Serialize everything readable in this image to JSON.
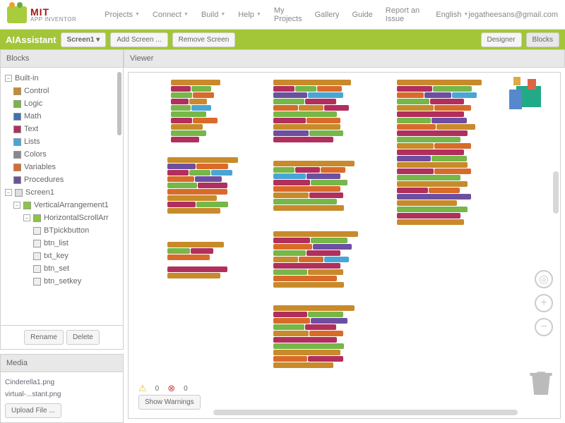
{
  "logo": {
    "mit": "MIT",
    "sub": "APP INVENTOR"
  },
  "menu": [
    "Projects",
    "Connect",
    "Build",
    "Help",
    "My Projects",
    "Gallery",
    "Guide",
    "Report an Issue",
    "English"
  ],
  "user": "jegatheesans@gmail.com",
  "project": "AIAssistant",
  "toolbar": {
    "screen": "Screen1",
    "add": "Add Screen ...",
    "remove": "Remove Screen",
    "designer": "Designer",
    "blocks": "Blocks"
  },
  "panels": {
    "blocks": "Blocks",
    "viewer": "Viewer",
    "media": "Media"
  },
  "builtin": {
    "label": "Built-in",
    "items": [
      {
        "label": "Control",
        "color": "#c88a2a"
      },
      {
        "label": "Logic",
        "color": "#77b648"
      },
      {
        "label": "Math",
        "color": "#3f71b5"
      },
      {
        "label": "Text",
        "color": "#b12f5d"
      },
      {
        "label": "Lists",
        "color": "#49a6d4"
      },
      {
        "label": "Colors",
        "color": "#888888"
      },
      {
        "label": "Variables",
        "color": "#d96b2a"
      },
      {
        "label": "Procedures",
        "color": "#6d4fa0"
      }
    ]
  },
  "screen": {
    "label": "Screen1",
    "items": [
      {
        "label": "VerticalArrangement1",
        "color": "#8cc63f",
        "exp": true
      },
      {
        "label": "HorizontalScrollArr",
        "color": "#8cc63f",
        "exp": true,
        "ind": 2
      },
      {
        "label": "BTpickbutton",
        "ind": 3
      },
      {
        "label": "btn_list",
        "ind": 3
      },
      {
        "label": "txt_key",
        "ind": 3
      },
      {
        "label": "btn_set",
        "ind": 3
      },
      {
        "label": "btn_setkey",
        "ind": 3
      }
    ]
  },
  "btns": {
    "rename": "Rename",
    "delete": "Delete",
    "upload": "Upload File ...",
    "showw": "Show Warnings"
  },
  "media": [
    "Cinderella1.png",
    "virtual-...stant.png"
  ],
  "warn": {
    "w": "0",
    "e": "0"
  }
}
